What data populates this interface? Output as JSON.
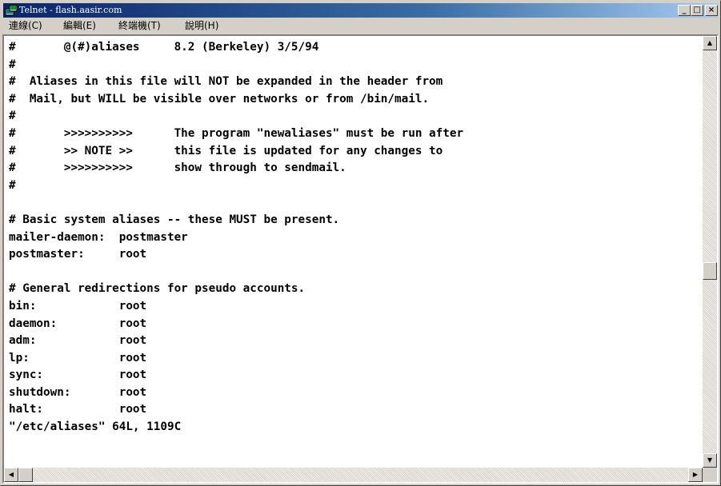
{
  "window": {
    "title": "Telnet - flash.aasir.com",
    "controls": {
      "minimize_glyph": "_",
      "maximize_glyph": "□",
      "close_glyph": "×"
    }
  },
  "menu": {
    "items": [
      "連線(C)",
      "編輯(E)",
      "終端機(T)",
      "說明(H)"
    ]
  },
  "terminal": {
    "lines": [
      "#       @(#)aliases     8.2 (Berkeley) 3/5/94",
      "#",
      "#  Aliases in this file will NOT be expanded in the header from",
      "#  Mail, but WILL be visible over networks or from /bin/mail.",
      "#",
      "#       >>>>>>>>>>      The program \"newaliases\" must be run after",
      "#       >> NOTE >>      this file is updated for any changes to",
      "#       >>>>>>>>>>      show through to sendmail.",
      "#",
      "",
      "# Basic system aliases -- these MUST be present.",
      "mailer-daemon:  postmaster",
      "postmaster:     root",
      "",
      "# General redirections for pseudo accounts.",
      "bin:            root",
      "daemon:         root",
      "adm:            root",
      "lp:             root",
      "sync:           root",
      "shutdown:       root",
      "halt:           root",
      "\"/etc/aliases\" 64L, 1109C"
    ]
  },
  "scrollbars": {
    "vertical_position": 0.55,
    "horizontal_position": 0.0,
    "up_glyph": "▲",
    "down_glyph": "▼",
    "left_glyph": "◀",
    "right_glyph": "▶"
  }
}
